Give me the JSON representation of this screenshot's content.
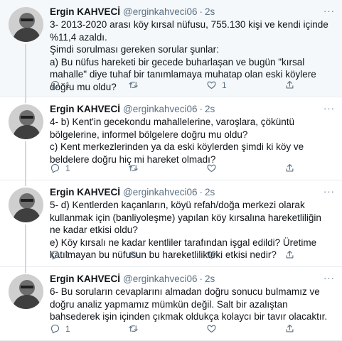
{
  "tweets": [
    {
      "name": "Ergin KAHVECİ",
      "handle": "@erginkahveci06",
      "dot": "·",
      "time": "2s",
      "lines": [
        "3- 2013-2020 arası köy kırsal nüfusu, 755.130 kişi ve kendi içinde %11,4 azaldı.",
        "Şimdi sorulması gereken sorular şunlar:",
        "a) Bu nüfus hareketi bir gecede buharlaşan ve bugün \"kırsal mahalle\" diye tuhaf bir tanımlamaya muhatap olan eski köylere doğru mu oldu?"
      ],
      "reply_count": "1",
      "retweet_count": "",
      "like_count": "1"
    },
    {
      "name": "Ergin KAHVECİ",
      "handle": "@erginkahveci06",
      "dot": "·",
      "time": "2s",
      "lines": [
        "4- b) Kent'in gecekondu mahallelerine, varoşlara, çöküntü bölgelerine, informel bölgelere doğru mu oldu?",
        "c) Kent merkezlerinden ya da eski köylerden şimdi ki köy ve beldelere doğru hiç mi hareket olmadı?"
      ],
      "reply_count": "1",
      "retweet_count": "",
      "like_count": ""
    },
    {
      "name": "Ergin KAHVECİ",
      "handle": "@erginkahveci06",
      "dot": "·",
      "time": "2s",
      "lines": [
        "5- d) Kentlerden kaçanların, köyü refah/doğa merkezi olarak kullanmak için (banliyoleşme) yapılan köy kırsalına hareketliliğin ne kadar etkisi oldu?",
        "e) Köy kırsalı ne kadar kentliler tarafından işgal edildi? Üretime katılmayan bu nüfusun bu hareketlilikteki etkisi nedir?"
      ],
      "reply_count": "1",
      "retweet_count": "",
      "like_count": ""
    },
    {
      "name": "Ergin KAHVECİ",
      "handle": "@erginkahveci06",
      "dot": "·",
      "time": "2s",
      "lines": [
        "6- Bu soruların cevaplarını almadan doğru sonucu bulmamız ve doğru analiz yapmamız mümkün değil. Salt bir azalıştan bahsederek işin içinden çıkmak oldukça kolaycı bir tavır olacaktır."
      ],
      "reply_count": "1",
      "retweet_count": "",
      "like_count": ""
    }
  ],
  "icons": {
    "reply": "reply-icon",
    "retweet": "retweet-icon",
    "like": "like-icon",
    "share": "share-icon",
    "more": "more-icon"
  },
  "colors": {
    "muted": "#5b7083",
    "highlight_bg": "#f5f8fa",
    "border": "#e6ecf0"
  }
}
